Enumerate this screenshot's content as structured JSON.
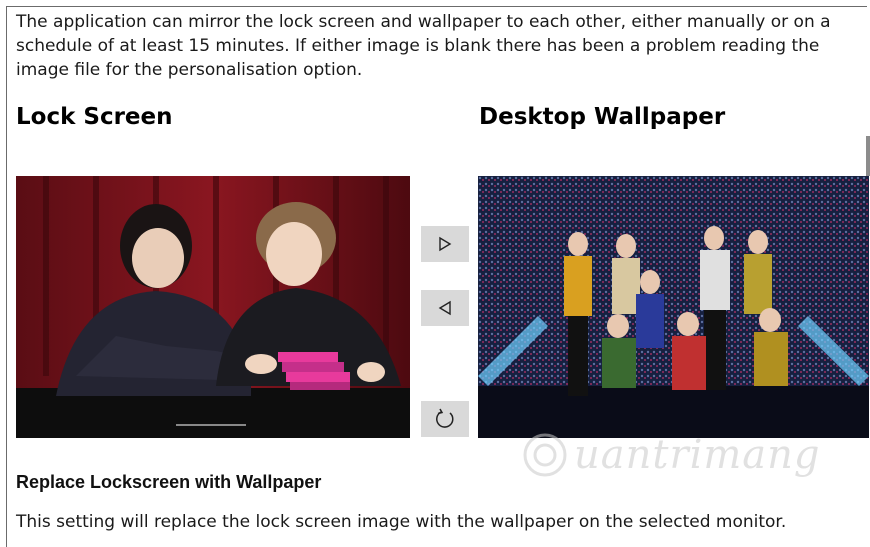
{
  "description": "The application can mirror the lock screen and wallpaper to each other, either manually or on a schedule of at least 15 minutes. If either image is blank there has been a problem reading the image file for the personalisation option.",
  "lock_screen": {
    "title": "Lock Screen"
  },
  "desktop_wallpaper": {
    "title": "Desktop Wallpaper"
  },
  "controls": {
    "copy_to_wallpaper_icon": "triangle-right-icon",
    "copy_to_lockscreen_icon": "triangle-left-icon",
    "refresh_icon": "refresh-icon"
  },
  "replace_section": {
    "title": "Replace Lockscreen with Wallpaper",
    "description": "This setting will replace the lock screen image with the wallpaper on the selected monitor."
  },
  "watermark": {
    "text": "uantrimang"
  },
  "colors": {
    "button_bg": "#d9d9d9",
    "text": "#111111"
  }
}
